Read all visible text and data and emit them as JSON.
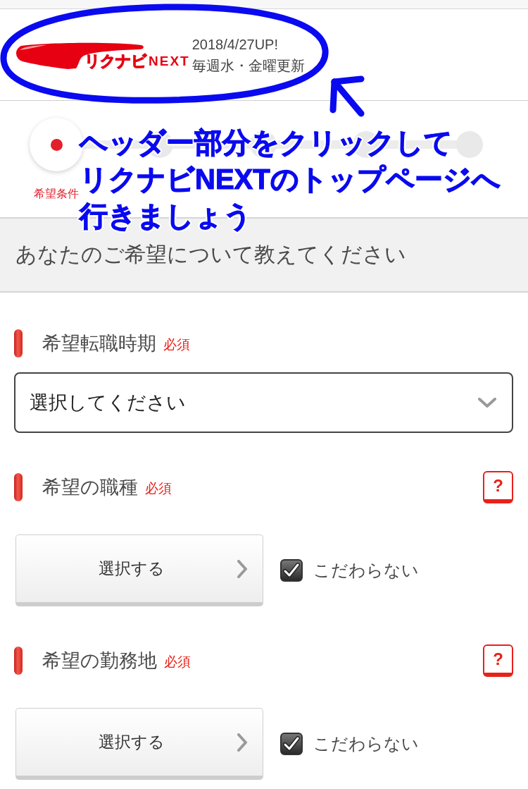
{
  "header": {
    "logo": {
      "mark": "リクナビ",
      "suffix": "NEXT"
    },
    "update_date": "2018/4/27UP!",
    "update_schedule": "毎週水・金曜更新"
  },
  "stepper": {
    "steps": [
      {
        "label": "希望条件",
        "selected": true
      },
      {
        "selected": false
      },
      {
        "selected": false
      },
      {
        "selected": false
      },
      {
        "selected": false
      }
    ]
  },
  "annotation": {
    "lines": [
      "ヘッダー部分をクリックして",
      "リクナビNEXTのトップページへ",
      "行きましょう"
    ]
  },
  "section": {
    "title": "あなたのご希望について教えてください"
  },
  "fields": [
    {
      "kind": "select",
      "label": "希望転職時期",
      "badge": "必須",
      "value": "選択してください"
    },
    {
      "kind": "picker",
      "label": "希望の職種",
      "badge": "必須",
      "help": "?",
      "button": "選択する",
      "checkbox": {
        "label": "こだわらない",
        "checked": true
      }
    },
    {
      "kind": "picker",
      "label": "希望の勤務地",
      "badge": "必須",
      "help": "?",
      "button": "選択する",
      "checkbox": {
        "label": "こだわらない",
        "checked": true
      }
    }
  ]
}
